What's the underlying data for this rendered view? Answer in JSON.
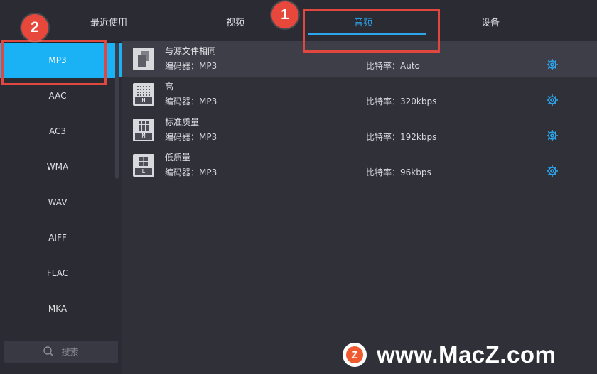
{
  "tabs": [
    {
      "label": "最近使用",
      "active": false
    },
    {
      "label": "视频",
      "active": false
    },
    {
      "label": "音频",
      "active": true
    },
    {
      "label": "设备",
      "active": false
    }
  ],
  "sidebar": {
    "formats": [
      "MP3",
      "AAC",
      "AC3",
      "WMA",
      "WAV",
      "AIFF",
      "FLAC",
      "MKA"
    ],
    "selected": "MP3",
    "search_placeholder": "搜索"
  },
  "presets": [
    {
      "name": "与源文件相同",
      "encoder": "编码器：MP3",
      "bitrate": "比特率：Auto",
      "icon": "same-as-source-icon",
      "letter": ""
    },
    {
      "name": "高",
      "encoder": "编码器：MP3",
      "bitrate": "比特率：320kbps",
      "icon": "high-quality-icon",
      "letter": "H"
    },
    {
      "name": "标准质量",
      "encoder": "编码器：MP3",
      "bitrate": "比特率：192kbps",
      "icon": "medium-quality-icon",
      "letter": "M"
    },
    {
      "name": "低质量",
      "encoder": "编码器：MP3",
      "bitrate": "比特率：96kbps",
      "icon": "low-quality-icon",
      "letter": "L"
    }
  ],
  "annotations": [
    {
      "label": "1"
    },
    {
      "label": "2"
    }
  ],
  "watermark": {
    "logo_letter": "Z",
    "text": "www.MacZ.com"
  },
  "colors": {
    "accent": "#2da6ee",
    "selected_bg": "#1ab2f5",
    "annotation_red": "#e0483f",
    "background": "#2f3038"
  },
  "icons": {
    "settings": "gear-icon",
    "search": "search-icon"
  }
}
